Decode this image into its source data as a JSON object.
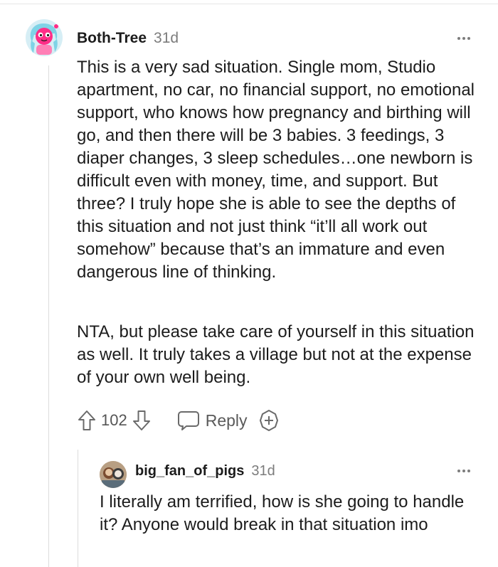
{
  "comment": {
    "username": "Both-Tree",
    "age": "31d",
    "avatar_icon": "snoo-avatar-icon",
    "paragraphs": [
      "This is a very sad situation. Single mom, Studio apartment, no car, no financial support, no emotional support, who knows how pregnancy and birthing will go, and then there will be 3 babies. 3 feedings, 3 diaper changes, 3 sleep schedules…one newborn is difficult even with money, time, and support. But three? I truly hope she is able to see the depths of this situation and not just think “it’ll all work out somehow” because that’s an immature and even dangerous line of thinking.",
      "NTA, but please take care of yourself in this situation as well. It truly takes a village but not at the expense of your own well being."
    ],
    "score": "102",
    "reply_label": "Reply"
  },
  "reply": {
    "username": "big_fan_of_pigs",
    "age": "31d",
    "avatar_icon": "user-avatar-icon",
    "text": "I literally am terrified, how is she going to handle it? Anyone would break in that situation imo"
  },
  "colors": {
    "avatar_bg": "#d6eef5",
    "accent_pink": "#ff2d87",
    "hair_teal": "#7fd3e6",
    "meta_gray": "#7c7c7c",
    "divider": "#dcdcdc"
  }
}
